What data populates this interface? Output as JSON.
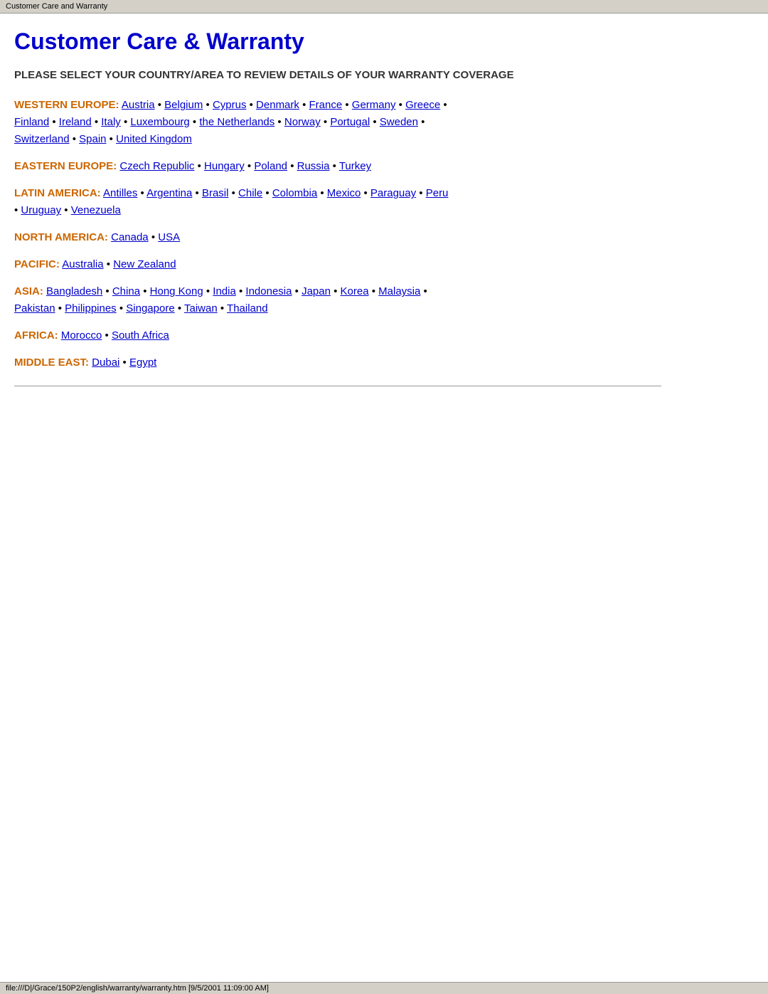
{
  "browser": {
    "tab_title": "Customer Care and Warranty"
  },
  "page": {
    "title": "Customer Care & Warranty",
    "subtitle": "PLEASE SELECT YOUR COUNTRY/AREA TO REVIEW DETAILS OF YOUR WARRANTY COVERAGE"
  },
  "regions": [
    {
      "id": "western-europe",
      "label": "WESTERN EUROPE:",
      "countries": [
        {
          "name": "Austria",
          "href": "#"
        },
        {
          "name": "Belgium",
          "href": "#"
        },
        {
          "name": "Cyprus",
          "href": "#"
        },
        {
          "name": "Denmark",
          "href": "#"
        },
        {
          "name": "France",
          "href": "#"
        },
        {
          "name": "Germany",
          "href": "#"
        },
        {
          "name": "Greece",
          "href": "#"
        },
        {
          "name": "Finland",
          "href": "#"
        },
        {
          "name": "Ireland",
          "href": "#"
        },
        {
          "name": "Italy",
          "href": "#"
        },
        {
          "name": "Luxembourg",
          "href": "#"
        },
        {
          "name": "the Netherlands",
          "href": "#"
        },
        {
          "name": "Norway",
          "href": "#"
        },
        {
          "name": "Portugal",
          "href": "#"
        },
        {
          "name": "Sweden",
          "href": "#"
        },
        {
          "name": "Switzerland",
          "href": "#"
        },
        {
          "name": "Spain",
          "href": "#"
        },
        {
          "name": "United Kingdom",
          "href": "#"
        }
      ]
    },
    {
      "id": "eastern-europe",
      "label": "EASTERN EUROPE:",
      "countries": [
        {
          "name": "Czech Republic",
          "href": "#"
        },
        {
          "name": "Hungary",
          "href": "#"
        },
        {
          "name": "Poland",
          "href": "#"
        },
        {
          "name": "Russia",
          "href": "#"
        },
        {
          "name": "Turkey",
          "href": "#"
        }
      ]
    },
    {
      "id": "latin-america",
      "label": "LATIN AMERICA:",
      "countries": [
        {
          "name": "Antilles",
          "href": "#"
        },
        {
          "name": "Argentina",
          "href": "#"
        },
        {
          "name": "Brasil",
          "href": "#"
        },
        {
          "name": "Chile",
          "href": "#"
        },
        {
          "name": "Colombia",
          "href": "#"
        },
        {
          "name": "Mexico",
          "href": "#"
        },
        {
          "name": "Paraguay",
          "href": "#"
        },
        {
          "name": "Peru",
          "href": "#"
        },
        {
          "name": "Uruguay",
          "href": "#"
        },
        {
          "name": "Venezuela",
          "href": "#"
        }
      ]
    },
    {
      "id": "north-america",
      "label": "NORTH AMERICA:",
      "countries": [
        {
          "name": "Canada",
          "href": "#"
        },
        {
          "name": "USA",
          "href": "#"
        }
      ]
    },
    {
      "id": "pacific",
      "label": "PACIFIC:",
      "countries": [
        {
          "name": "Australia",
          "href": "#"
        },
        {
          "name": "New Zealand",
          "href": "#"
        }
      ]
    },
    {
      "id": "asia",
      "label": "ASIA:",
      "countries": [
        {
          "name": "Bangladesh",
          "href": "#"
        },
        {
          "name": "China",
          "href": "#"
        },
        {
          "name": "Hong Kong",
          "href": "#"
        },
        {
          "name": "India",
          "href": "#"
        },
        {
          "name": "Indonesia",
          "href": "#"
        },
        {
          "name": "Japan",
          "href": "#"
        },
        {
          "name": "Korea",
          "href": "#"
        },
        {
          "name": "Malaysia",
          "href": "#"
        },
        {
          "name": "Pakistan",
          "href": "#"
        },
        {
          "name": "Philippines",
          "href": "#"
        },
        {
          "name": "Singapore",
          "href": "#"
        },
        {
          "name": "Taiwan",
          "href": "#"
        },
        {
          "name": "Thailand",
          "href": "#"
        }
      ]
    },
    {
      "id": "africa",
      "label": "AFRICA:",
      "countries": [
        {
          "name": "Morocco",
          "href": "#"
        },
        {
          "name": "South Africa",
          "href": "#"
        }
      ]
    },
    {
      "id": "middle-east",
      "label": "MIDDLE EAST:",
      "countries": [
        {
          "name": "Dubai",
          "href": "#"
        },
        {
          "name": "Egypt",
          "href": "#"
        }
      ]
    }
  ],
  "status_bar": {
    "text": "file:///D|/Grace/150P2/english/warranty/warranty.htm [9/5/2001 11:09:00 AM]"
  }
}
